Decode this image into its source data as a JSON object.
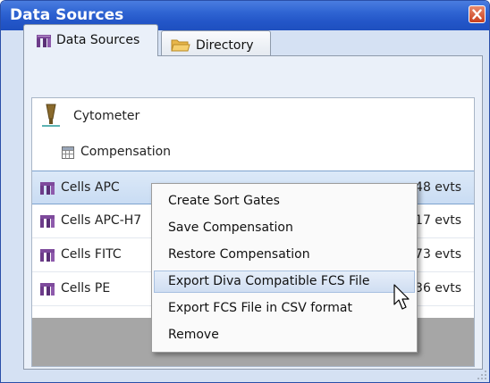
{
  "window": {
    "title": "Data Sources"
  },
  "tabs": [
    {
      "label": "Data Sources",
      "icon": "data-sources-icon"
    },
    {
      "label": "Directory",
      "icon": "folder-icon"
    }
  ],
  "list": {
    "cytometer": {
      "label": "Cytometer"
    },
    "compensation": {
      "label": "Compensation"
    },
    "items": [
      {
        "label": "Cells APC",
        "events": "48 evts",
        "selected": true
      },
      {
        "label": "Cells APC-H7",
        "events": "17 evts"
      },
      {
        "label": "Cells FITC",
        "events": "73 evts"
      },
      {
        "label": "Cells PE",
        "events": "36 evts"
      }
    ]
  },
  "context_menu": {
    "items": [
      {
        "label": "Create Sort Gates"
      },
      {
        "label": "Save Compensation"
      },
      {
        "label": "Restore Compensation"
      },
      {
        "label": "Export Diva Compatible FCS File",
        "hover": true
      },
      {
        "label": "Export FCS File in CSV format"
      },
      {
        "label": "Remove"
      }
    ]
  },
  "colors": {
    "title_bar": "#2356c8",
    "selection": "#c9dcf3",
    "close_button": "#c83f1e"
  }
}
